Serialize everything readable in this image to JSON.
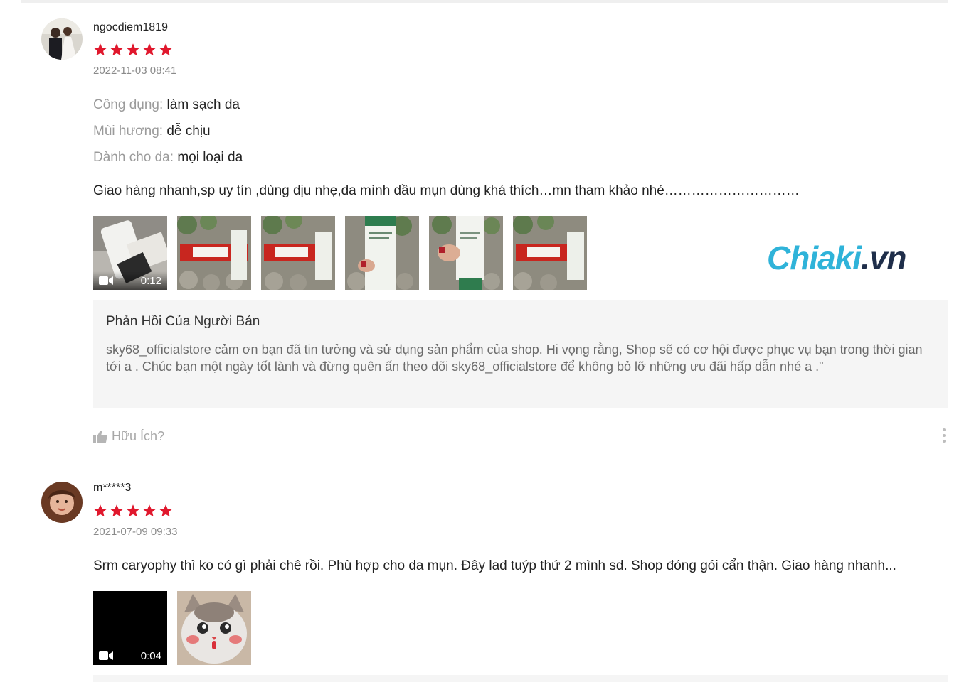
{
  "reviews": [
    {
      "username": "ngocdiem1819",
      "rating": 5,
      "date": "2022-11-03 08:41",
      "attributes": [
        {
          "key": "Công dụng:",
          "value": "làm sạch da"
        },
        {
          "key": "Mùi hương:",
          "value": "dễ chịu"
        },
        {
          "key": "Dành cho da:",
          "value": "mọi loại da"
        }
      ],
      "text": "Giao hàng nhanh,sp uy tín ,dùng dịu nhẹ,da mình dầu mụn dùng khá thích…mn tham khảo nhé…………………………",
      "video_duration": "0:12",
      "seller_reply": {
        "title": "Phản Hồi Của Người Bán",
        "body": "sky68_officialstore cảm ơn bạn đã tin tưởng và sử dụng sản phẩm của shop. Hi vọng rằng, Shop sẽ có cơ hội được phục vụ bạn trong thời gian tới a . Chúc bạn một ngày tốt lành và đừng quên ấn theo dõi sky68_officialstore để không bỏ lỡ những ưu đãi hấp dẫn nhé a .\""
      },
      "helpful_label": "Hữu Ích?"
    },
    {
      "username": "m*****3",
      "rating": 5,
      "date": "2021-07-09 09:33",
      "text": "Srm caryophy thì ko có gì phải chê rồi. Phù hợp cho da mụn. Đây lad tuýp thứ 2 mình sd. Shop đóng gói cẩn thận. Giao hàng nhanh...",
      "video_duration": "0:04"
    }
  ],
  "watermark": {
    "brand": "Chiaki",
    "domain": ".vn"
  },
  "colors": {
    "star": "#e0182d",
    "watermark": "#2fb3d9",
    "muted": "#9b9b9b"
  },
  "icons": {
    "star": "star-icon",
    "video": "video-camera-icon",
    "like": "thumbs-up-icon",
    "more": "more-vertical-icon"
  }
}
